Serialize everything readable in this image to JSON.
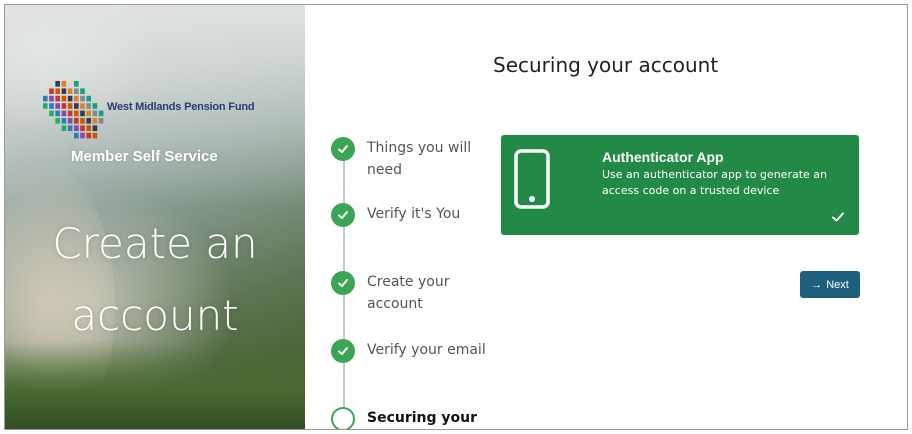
{
  "sidebar": {
    "org_name": "West Midlands Pension Fund",
    "service_name": "Member Self Service",
    "headline_line1": "Create an",
    "headline_line2": "account"
  },
  "main": {
    "title": "Securing your account",
    "steps": [
      {
        "label": "Things you will need",
        "status": "complete"
      },
      {
        "label": "Verify it's You",
        "status": "complete"
      },
      {
        "label": "Create your account",
        "status": "complete"
      },
      {
        "label": "Verify your email",
        "status": "complete"
      },
      {
        "label": "Securing your",
        "status": "current"
      }
    ],
    "option_card": {
      "title": "Authenticator App",
      "description": "Use an authenticator app to generate an access code on a trusted device",
      "selected": true,
      "icon": "mobile-phone-icon"
    },
    "next_button": {
      "label": "Next",
      "icon": "arrow-right-icon"
    }
  },
  "colors": {
    "accent_green": "#228a46",
    "step_green": "#3aa655",
    "button_blue": "#1f5f7e"
  }
}
